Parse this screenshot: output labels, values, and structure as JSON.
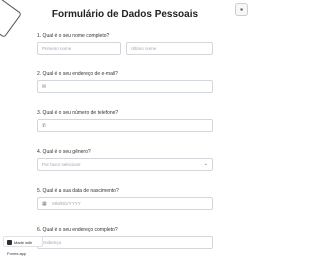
{
  "form": {
    "title": "Formulário de Dados Pessoais",
    "q1": {
      "label": "1. Qual é o seu nome completo?",
      "first_placeholder": "Primeiro nome",
      "last_placeholder": "Último nome"
    },
    "q2": {
      "label": "2. Qual é o seu endereço de e-mail?",
      "icon": "mail-icon",
      "value": ""
    },
    "q3": {
      "label": "3. Qual é o seu número de telefone?",
      "icon": "phone-icon",
      "value": ""
    },
    "q4": {
      "label": "4. Qual é o seu gênero?",
      "selected": "Por favor selecione"
    },
    "q5": {
      "label": "5. Qual é a sua data de nascimento?",
      "placeholder": "MM/DD/YYYY",
      "icon": "calendar-icon"
    },
    "q6": {
      "label": "6. Qual é o seu endereço completo?",
      "placeholder": "Endereço"
    }
  },
  "badge": {
    "text": "Made with Forms.app",
    "icon": "forms-app-logo-icon"
  },
  "top_right_button": {
    "icon": "settings-icon"
  }
}
